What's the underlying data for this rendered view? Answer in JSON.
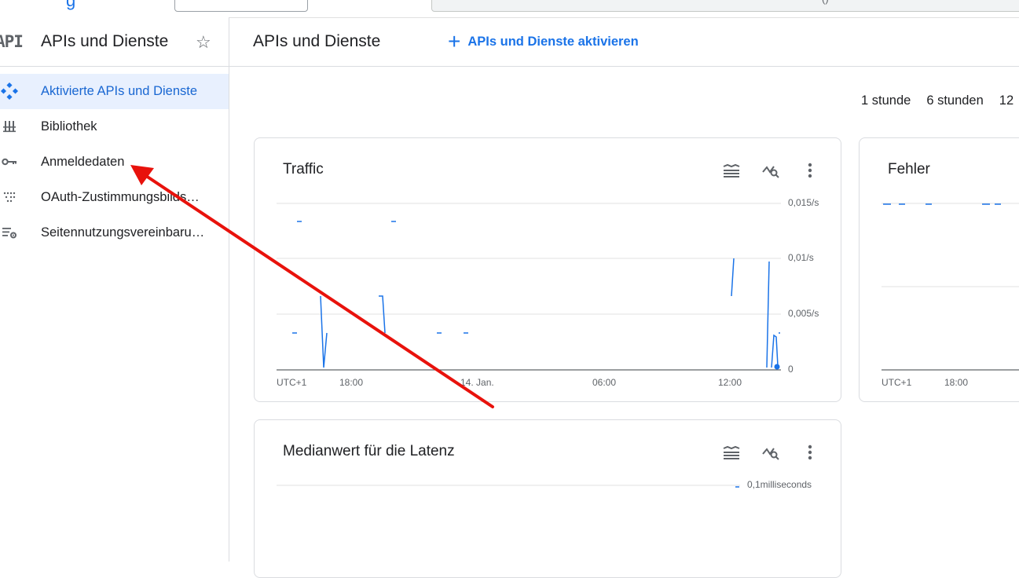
{
  "topbar": {
    "logo_fragment": "g",
    "right_fragment": "()"
  },
  "sidebar": {
    "glyph": "API",
    "title": "APIs und Dienste",
    "star_icon": "star-outline-icon",
    "items": [
      {
        "label": "Aktivierte APIs und Dienste",
        "icon": "api-diamond-icon",
        "active": true
      },
      {
        "label": "Bibliothek",
        "icon": "library-icon",
        "active": false
      },
      {
        "label": "Anmeldedaten",
        "icon": "key-icon",
        "active": false
      },
      {
        "label": "OAuth-Zustimmungsbilds…",
        "icon": "dots-consent-icon",
        "active": false
      },
      {
        "label": "Seitennutzungsvereinbaru…",
        "icon": "settings-list-icon",
        "active": false
      }
    ]
  },
  "main": {
    "title": "APIs und Dienste",
    "enable_button": "APIs und Dienste aktivieren",
    "time_ranges": [
      "1 stunde",
      "6 stunden",
      "12"
    ]
  },
  "cards": {
    "traffic": {
      "title": "Traffic",
      "y_ticks": [
        "0,015/s",
        "0,01/s",
        "0,005/s",
        "0"
      ],
      "x_ticks": [
        "UTC+1",
        "18:00",
        "14. Jan.",
        "06:00",
        "12:00"
      ]
    },
    "errors": {
      "title": "Fehler",
      "x_ticks": [
        "UTC+1",
        "18:00"
      ]
    },
    "latency": {
      "title": "Medianwert für die Latenz",
      "y_ticks": [
        "0,1milliseconds"
      ]
    }
  },
  "colors": {
    "accent": "#1a73e8",
    "annotation_arrow": "#e8120c",
    "active_bg": "#e8f0fe"
  }
}
